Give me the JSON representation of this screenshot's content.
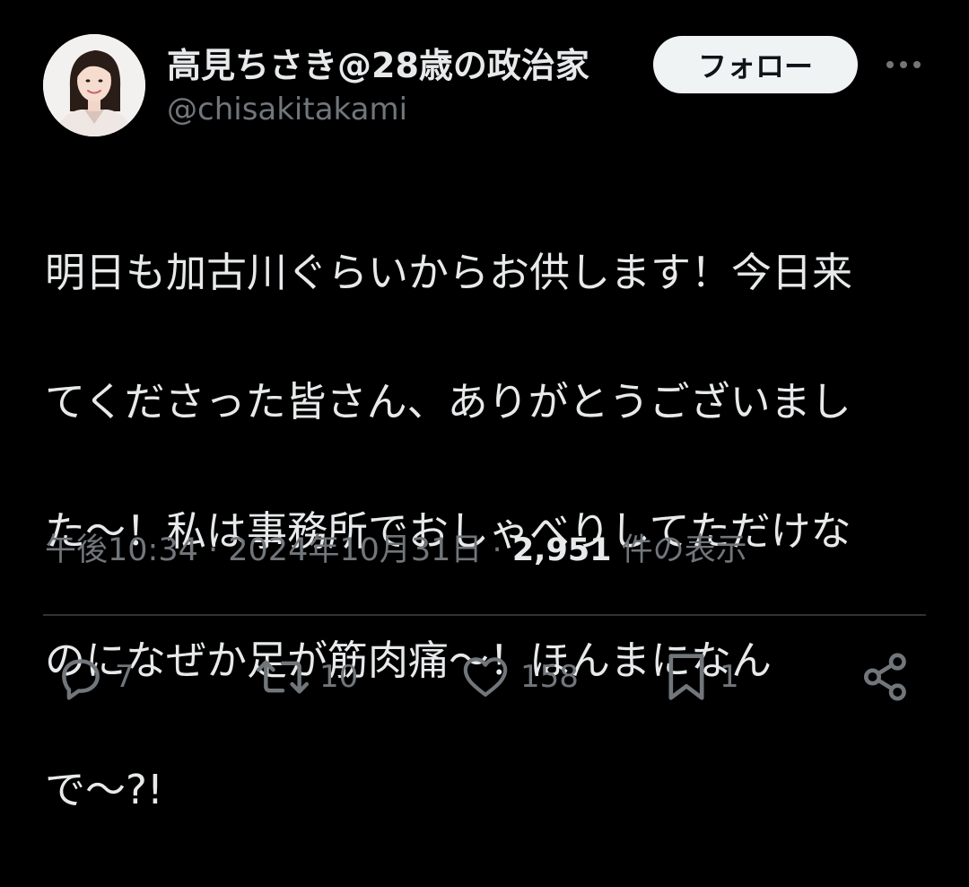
{
  "user": {
    "display_name": "高見ちさき@28歳の政治家",
    "handle": "@chisakitakami",
    "avatar_icon": "profile-photo"
  },
  "header": {
    "follow_label": "フォロー",
    "more_icon": "more-options-icon"
  },
  "tweet": {
    "text_lines": [
      "明日も加古川ぐらいからお供します！今日来",
      "てくださった皆さん、ありがとうございまし",
      "た〜！私は事務所でおしゃべりしてただけな",
      "のになぜか足が筋肉痛〜！ほんまになん",
      "で〜?!"
    ]
  },
  "meta": {
    "time": "午後10:34",
    "separator": " · ",
    "date": "2024年10月31日",
    "views_count": "2,951",
    "views_label": " 件の表示"
  },
  "actions": {
    "reply_count": "7",
    "retweet_count": "10",
    "like_count": "158",
    "bookmark_count": "1"
  },
  "colors": {
    "background": "#000000",
    "primary_text": "#e7e9ea",
    "secondary_text": "#71767b",
    "follow_bg": "#eff3f4",
    "divider": "#2f3336"
  }
}
